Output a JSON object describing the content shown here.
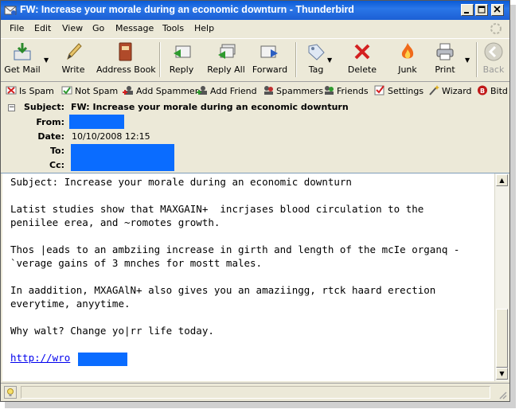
{
  "window": {
    "title": "FW: Increase your morale during an economic downturn - Thunderbird"
  },
  "menu": [
    "File",
    "Edit",
    "View",
    "Go",
    "Message",
    "Tools",
    "Help"
  ],
  "toolbar": {
    "get_mail": "Get Mail",
    "write": "Write",
    "address_book": "Address Book",
    "reply": "Reply",
    "reply_all": "Reply All",
    "forward": "Forward",
    "tag": "Tag",
    "delete": "Delete",
    "junk": "Junk",
    "print": "Print",
    "back": "Back"
  },
  "spambar": {
    "is_spam": "Is Spam",
    "not_spam": "Not Spam",
    "add_spammer": "Add Spammer",
    "add_friend": "Add Friend",
    "spammers": "Spammers",
    "friends": "Friends",
    "settings": "Settings",
    "wizard": "Wizard",
    "bitdefender": "Bitd"
  },
  "header": {
    "subject_label": "Subject:",
    "subject": "FW: Increase your morale during an economic downturn",
    "from_label": "From:",
    "date_label": "Date:",
    "date": "10/10/2008 12:15",
    "to_label": "To:",
    "cc_label": "Cc:"
  },
  "message": {
    "line1": "Subject: Increase your morale during an economic downturn",
    "line2": "Latist studies show that MAXGAIN+  incrjases blood circulation to the",
    "line3": "peniilee erea, and ~romotes growth.",
    "line4": "Thos |eads to an ambziing increase in girth and length of the mcIe organq -",
    "line5": "`verage gains of 3 mnches for mostt males.",
    "line6": "In aaddition, MXAGAlN+ also gives you an amaziingg, rtck haard erection",
    "line7": "everytime, anyytime.",
    "line8": "Why walt? Change yo|rr life today.",
    "link": "http://wro"
  },
  "colors": {
    "titlebar": "#0a5bd6",
    "chrome": "#ece9d8",
    "redaction": "#0a6cff",
    "link": "#0000ee"
  }
}
